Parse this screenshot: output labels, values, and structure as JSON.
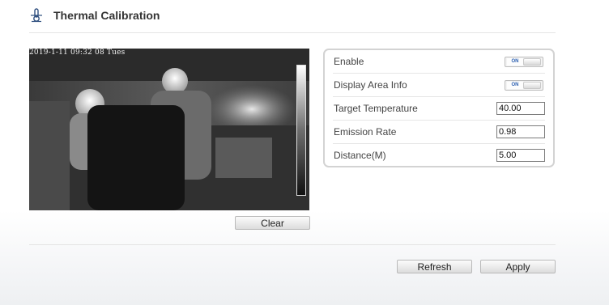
{
  "page": {
    "title": "Thermal Calibration",
    "title_icon": "thermometer-icon"
  },
  "video": {
    "osd_text": "2019-1-11 09:32 08 Tues"
  },
  "buttons": {
    "clear": "Clear",
    "refresh": "Refresh",
    "apply": "Apply"
  },
  "settings": {
    "enable": {
      "label": "Enable",
      "toggle": "ON",
      "state": true
    },
    "display_area_info": {
      "label": "Display Area Info",
      "toggle": "ON",
      "state": true
    },
    "target_temperature": {
      "label": "Target Temperature",
      "value": "40.00"
    },
    "emission_rate": {
      "label": "Emission Rate",
      "value": "0.98"
    },
    "distance": {
      "label": "Distance(M)",
      "value": "5.00"
    }
  },
  "colors": {
    "toggle_on_text": "#2b5fb0",
    "panel_border": "#d3d3d3"
  }
}
